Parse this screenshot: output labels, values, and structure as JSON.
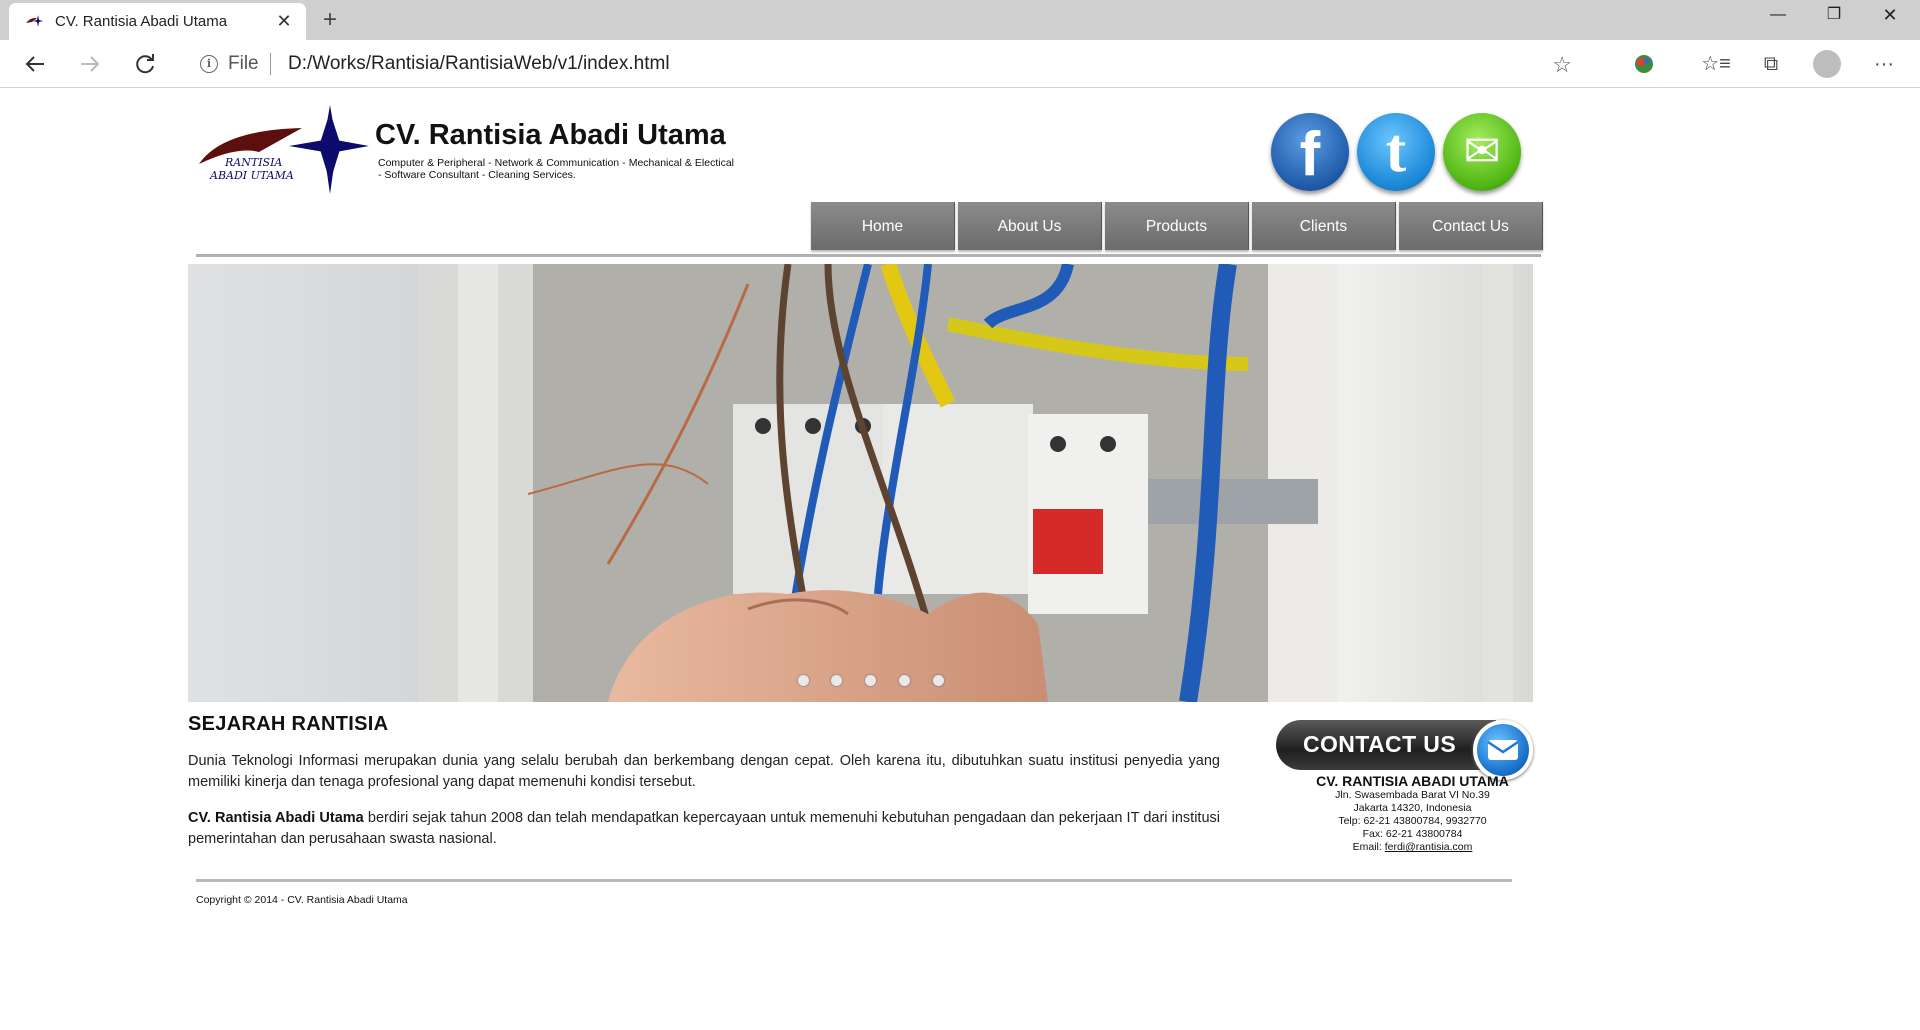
{
  "browser": {
    "tab_title": "CV. Rantisia Abadi Utama",
    "url_scheme": "File",
    "url": "D:/Works/Rantisia/RantisiaWeb/v1/index.html"
  },
  "site": {
    "title": "CV. Rantisia Abadi Utama",
    "tagline": "Computer & Peripheral - Network & Communication - Mechanical & Electical - Software Consultant - Cleaning Services.",
    "logo_text_1": "RANTISIA",
    "logo_text_2": "ABADI UTAMA",
    "brand_color": "#0d0b6e"
  },
  "social": [
    {
      "name": "facebook",
      "glyph": "f",
      "color": "#2f6fc2"
    },
    {
      "name": "twitter",
      "glyph": "t",
      "color": "#1a9be0"
    },
    {
      "name": "email",
      "glyph": "✉",
      "color": "#56c21c"
    }
  ],
  "menu": [
    "Home",
    "About Us",
    "Products",
    "Clients",
    "Contact Us"
  ],
  "slider": {
    "dot_count": 5
  },
  "content": {
    "heading": "SEJARAH RANTISIA",
    "p1": "Dunia Teknologi Informasi merupakan dunia yang selalu berubah dan berkembang dengan cepat. Oleh karena itu, dibutuhkan suatu institusi penyedia yang memiliki kinerja dan tenaga profesional yang dapat memenuhi kondisi tersebut.",
    "p2_bold": "CV. Rantisia Abadi Utama",
    "p2_rest": " berdiri sejak tahun 2008 dan telah mendapatkan kepercayaan untuk memenuhi kebutuhan pengadaan dan pekerjaan IT dari institusi pemerintahan dan perusahaan swasta nasional."
  },
  "contact": {
    "banner": "CONTACT US",
    "company": "CV. RANTISIA ABADI UTAMA",
    "address1": "Jln. Swasembada Barat VI No.39",
    "address2": "Jakarta 14320, Indonesia",
    "phone": "Telp: 62-21 43800784, 9932770",
    "fax": "Fax: 62-21 43800784",
    "email_label": "Email: ",
    "email": "ferdi@rantisia.com"
  },
  "footer": {
    "copyright": "Copyright © 2014 - CV. Rantisia Abadi Utama"
  }
}
